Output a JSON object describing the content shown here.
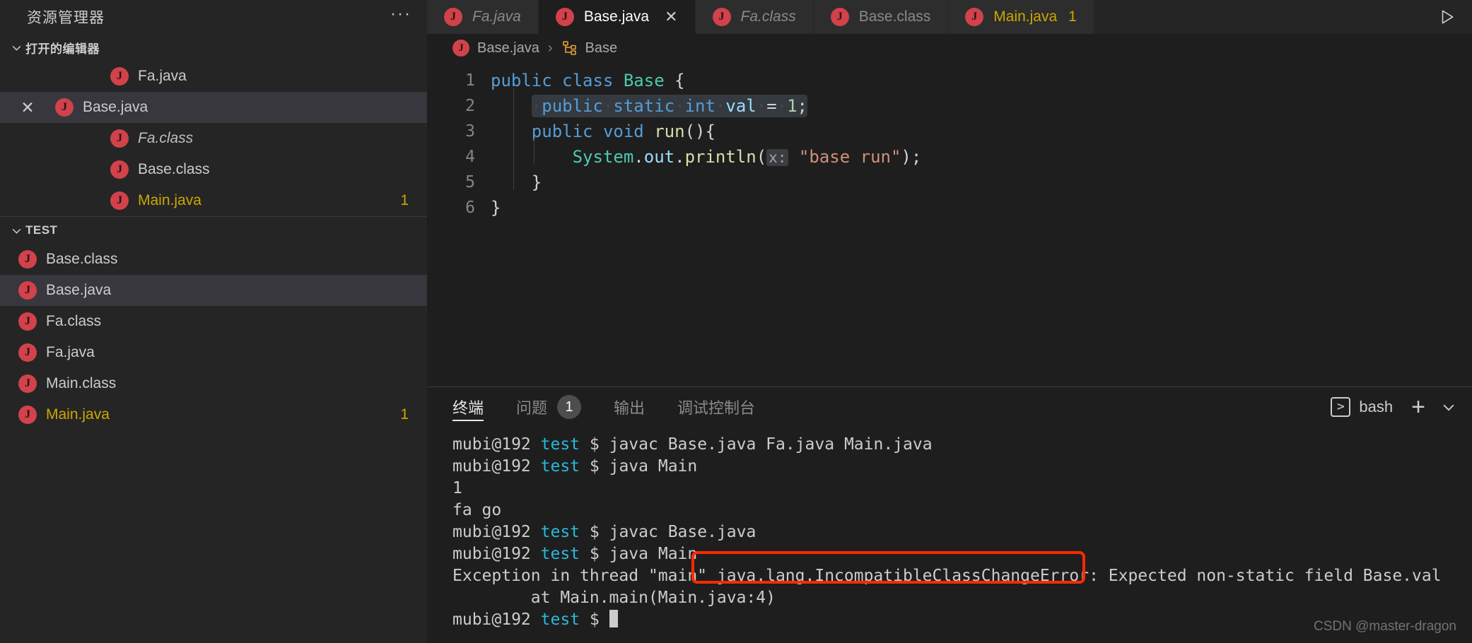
{
  "sidebar": {
    "title": "资源管理器",
    "more_icon": "ellipsis-icon",
    "open_editors": {
      "label": "打开的编辑器",
      "items": [
        {
          "name": "Fa.java",
          "icon": "java-file-icon",
          "style": "normal",
          "badge": "",
          "selected": false,
          "close": ""
        },
        {
          "name": "Base.java",
          "icon": "java-file-icon",
          "style": "normal",
          "badge": "",
          "selected": true,
          "close": "✕"
        },
        {
          "name": "Fa.class",
          "icon": "java-file-icon",
          "style": "italic",
          "badge": "",
          "selected": false,
          "close": ""
        },
        {
          "name": "Base.class",
          "icon": "java-file-icon",
          "style": "normal",
          "badge": "",
          "selected": false,
          "close": ""
        },
        {
          "name": "Main.java",
          "icon": "java-file-icon",
          "style": "warn",
          "badge": "1",
          "selected": false,
          "close": ""
        }
      ]
    },
    "folder": {
      "label": "TEST",
      "items": [
        {
          "name": "Base.class",
          "icon": "java-file-icon",
          "style": "normal",
          "badge": "",
          "selected": false
        },
        {
          "name": "Base.java",
          "icon": "java-file-icon",
          "style": "normal",
          "badge": "",
          "selected": true
        },
        {
          "name": "Fa.class",
          "icon": "java-file-icon",
          "style": "normal",
          "badge": "",
          "selected": false
        },
        {
          "name": "Fa.java",
          "icon": "java-file-icon",
          "style": "normal",
          "badge": "",
          "selected": false
        },
        {
          "name": "Main.class",
          "icon": "java-file-icon",
          "style": "normal",
          "badge": "",
          "selected": false
        },
        {
          "name": "Main.java",
          "icon": "java-file-icon",
          "style": "warn",
          "badge": "1",
          "selected": false
        }
      ]
    }
  },
  "tabbar": {
    "tabs": [
      {
        "label": "Fa.java",
        "style": "italic",
        "active": false,
        "close": "",
        "badge": ""
      },
      {
        "label": "Base.java",
        "style": "normal",
        "active": true,
        "close": "✕",
        "badge": ""
      },
      {
        "label": "Fa.class",
        "style": "italic",
        "active": false,
        "close": "",
        "badge": ""
      },
      {
        "label": "Base.class",
        "style": "normal",
        "active": false,
        "close": "",
        "badge": ""
      },
      {
        "label": "Main.java",
        "style": "warn",
        "active": false,
        "close": "",
        "badge": "1"
      }
    ],
    "run_icon": "play-run-icon"
  },
  "breadcrumb": {
    "file": "Base.java",
    "separator": "›",
    "symbol": "Base",
    "file_icon": "java-file-icon",
    "symbol_icon": "class-symbol-icon"
  },
  "editor": {
    "language": "java",
    "lines": [
      {
        "no": "1",
        "text": "public class Base {"
      },
      {
        "no": "2",
        "text": "    public static int val = 1;",
        "highlighted": true
      },
      {
        "no": "3",
        "text": "    public void run(){"
      },
      {
        "no": "4",
        "text": "        System.out.println(x: \"base run\");"
      },
      {
        "no": "5",
        "text": "    }"
      },
      {
        "no": "6",
        "text": "}"
      }
    ],
    "inlay_hint": "x:"
  },
  "panel": {
    "tabs": [
      {
        "label": "终端",
        "active": true,
        "badge": ""
      },
      {
        "label": "问题",
        "active": false,
        "badge": "1"
      },
      {
        "label": "输出",
        "active": false,
        "badge": ""
      },
      {
        "label": "调试控制台",
        "active": false,
        "badge": ""
      }
    ],
    "shell_icon": "terminal-icon",
    "shell_glyph": ">",
    "shell_name": "bash",
    "new_terminal_icon": "plus-icon",
    "split_icon": "chevron-down-icon",
    "terminal": {
      "prompt_user": "mubi@192",
      "prompt_dir": "test",
      "prompt_symbol": "$",
      "lines": [
        {
          "type": "cmd",
          "cmd": "javac Base.java Fa.java Main.java"
        },
        {
          "type": "cmd",
          "cmd": "java Main"
        },
        {
          "type": "out",
          "text": "1"
        },
        {
          "type": "out",
          "text": "fa go"
        },
        {
          "type": "cmd",
          "cmd": "javac Base.java"
        },
        {
          "type": "cmd",
          "cmd": "java Main"
        },
        {
          "type": "out",
          "text": "Exception in thread \"main\" java.lang.IncompatibleClassChangeError: Expected non-static field Base.val"
        },
        {
          "type": "out",
          "text": "        at Main.main(Main.java:4)"
        },
        {
          "type": "cmd",
          "cmd": ""
        }
      ]
    }
  },
  "annotation": {
    "highlight_color": "#ff2a00",
    "highlighted_text": "java.lang.IncompatibleClassChangeError:"
  },
  "watermark": "CSDN @master-dragon",
  "colors": {
    "accent_yellow": "#cca700",
    "java_icon_red": "#d1424b",
    "terminal_dir_cyan": "#29b8db",
    "editor_bg": "#1e1e1e",
    "sidebar_bg": "#252526"
  }
}
